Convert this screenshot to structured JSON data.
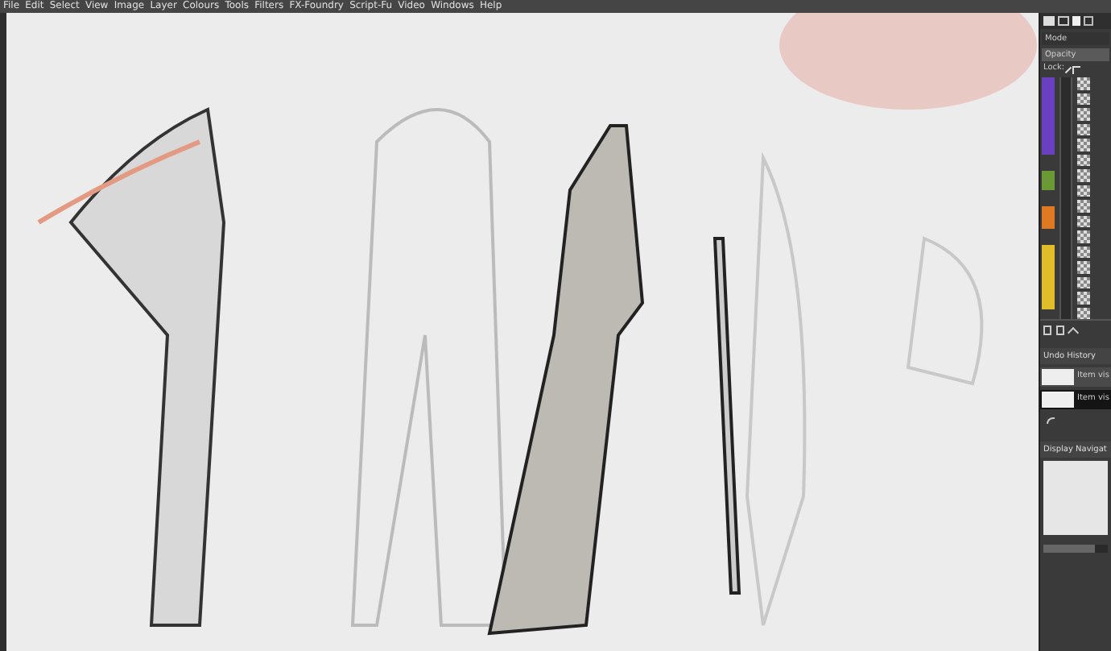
{
  "menu_bar": {
    "items": [
      "File",
      "Edit",
      "Select",
      "View",
      "Image",
      "Layer",
      "Colours",
      "Tools",
      "Filters",
      "FX-Foundry",
      "Script-Fu",
      "Video",
      "Windows",
      "Help"
    ]
  },
  "layers_panel": {
    "mode_label": "Mode",
    "opacity": {
      "label": "Opacity",
      "level": 1.0
    },
    "lock_label": "Lock:",
    "layers": [
      {
        "color": "#6a3fc0"
      },
      {
        "color": "#6a9a35"
      },
      {
        "color": "#e07a22"
      },
      {
        "color": "#e2bd2a"
      }
    ]
  },
  "undo_history": {
    "title": "Undo History",
    "items": [
      {
        "label": "Item vis",
        "selected": false
      },
      {
        "label": "Item vis",
        "selected": true
      }
    ]
  },
  "navigator": {
    "title": "Display Navigat",
    "zoom_slider": {
      "level": 0.8
    }
  }
}
